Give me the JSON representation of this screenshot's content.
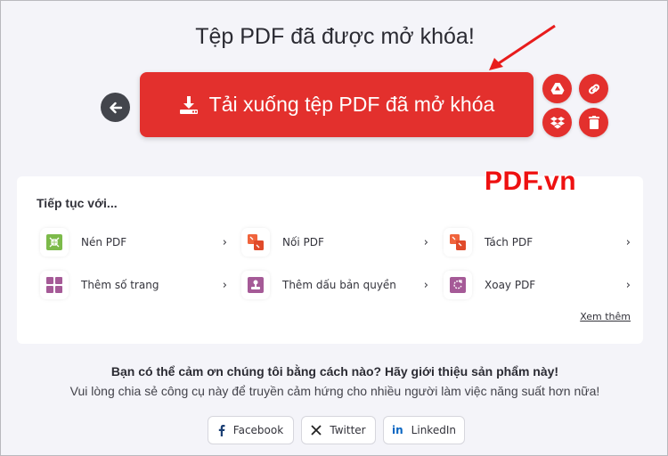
{
  "page": {
    "title": "Tệp PDF đã được mở khóa!",
    "download_label": "Tải xuống tệp PDF đã mở khóa",
    "watermark": "PDF.vn"
  },
  "actions": {
    "back": "arrow-left-icon",
    "google_drive": "google-drive-icon",
    "copy_link": "link-icon",
    "dropbox": "dropbox-icon",
    "delete": "trash-icon"
  },
  "continue": {
    "heading": "Tiếp tục với...",
    "tools": [
      {
        "label": "Nén PDF",
        "icon": "compress-icon",
        "color": "#7cba4a"
      },
      {
        "label": "Nối PDF",
        "icon": "merge-icon",
        "color": "#f0643c"
      },
      {
        "label": "Tách PDF",
        "icon": "split-icon",
        "color": "#f0643c"
      },
      {
        "label": "Thêm số trang",
        "icon": "page-numbers-icon",
        "color": "#a55a97"
      },
      {
        "label": "Thêm dấu bản quyền",
        "icon": "watermark-stamp-icon",
        "color": "#a55a97"
      },
      {
        "label": "Xoay PDF",
        "icon": "rotate-icon",
        "color": "#a55a97"
      }
    ],
    "see_more": "Xem thêm"
  },
  "share": {
    "heading": "Bạn có thể cảm ơn chúng tôi bằng cách nào? Hãy giới thiệu sản phẩm này!",
    "subtext": "Vui lòng chia sẻ công cụ này để truyền cảm hứng cho nhiều người làm việc năng suất hơn nữa!",
    "buttons": [
      {
        "label": "Facebook",
        "icon": "facebook-icon"
      },
      {
        "label": "Twitter",
        "icon": "x-twitter-icon"
      },
      {
        "label": "LinkedIn",
        "icon": "linkedin-icon"
      }
    ]
  },
  "colors": {
    "accent": "#e3302d",
    "background": "#f4f4f9",
    "back_button": "#43454c"
  }
}
